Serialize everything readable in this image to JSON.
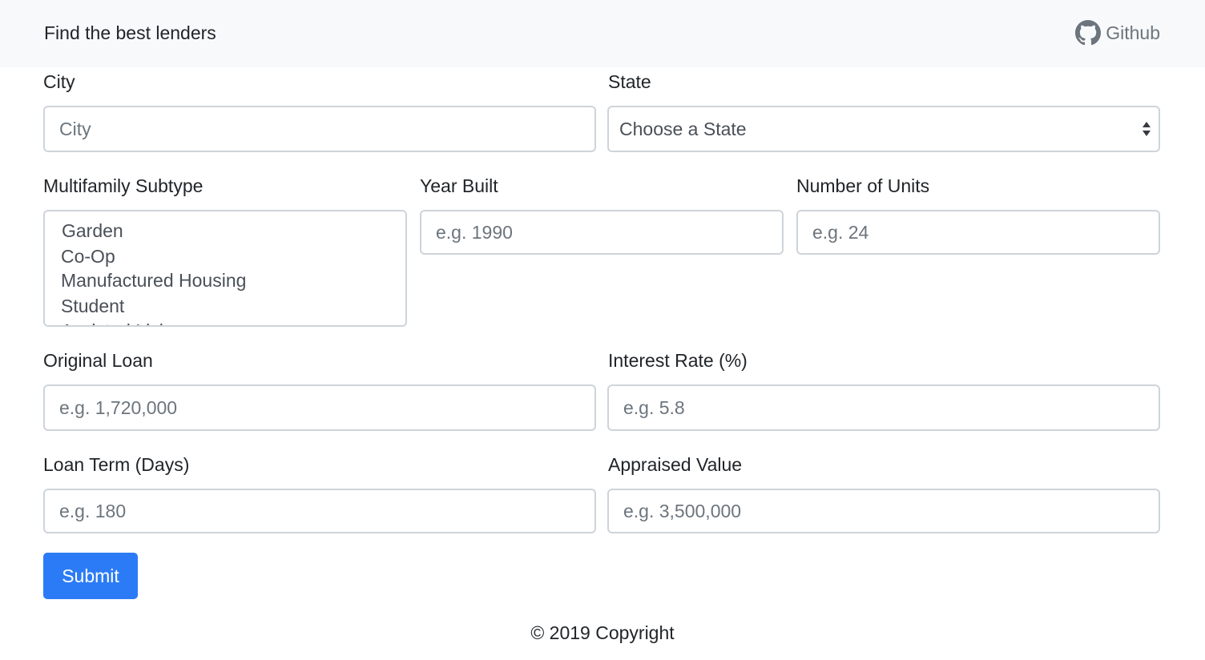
{
  "navbar": {
    "brand": "Find the best lenders",
    "github_label": "Github",
    "github_icon": "github-icon"
  },
  "form": {
    "city": {
      "label": "City",
      "placeholder": "City"
    },
    "state": {
      "label": "State",
      "selected": "Choose a State"
    },
    "subtype": {
      "label": "Multifamily Subtype",
      "options": [
        "Garden",
        "Co-Op",
        "Manufactured Housing",
        "Student",
        "Assisted Living"
      ]
    },
    "year_built": {
      "label": "Year Built",
      "placeholder": "e.g. 1990"
    },
    "units": {
      "label": "Number of Units",
      "placeholder": "e.g. 24"
    },
    "original_loan": {
      "label": "Original Loan",
      "placeholder": "e.g. 1,720,000"
    },
    "interest_rate": {
      "label": "Interest Rate (%)",
      "placeholder": "e.g. 5.8"
    },
    "loan_term": {
      "label": "Loan Term (Days)",
      "placeholder": "e.g. 180"
    },
    "appraised_value": {
      "label": "Appraised Value",
      "placeholder": "e.g. 3,500,000"
    },
    "submit_label": "Submit"
  },
  "footer": {
    "copyright": "© 2019 Copyright"
  },
  "colors": {
    "navbar_bg": "#f8f9fa",
    "primary": "#2c7bf6",
    "border": "#ced4da",
    "placeholder": "#6c757d"
  }
}
